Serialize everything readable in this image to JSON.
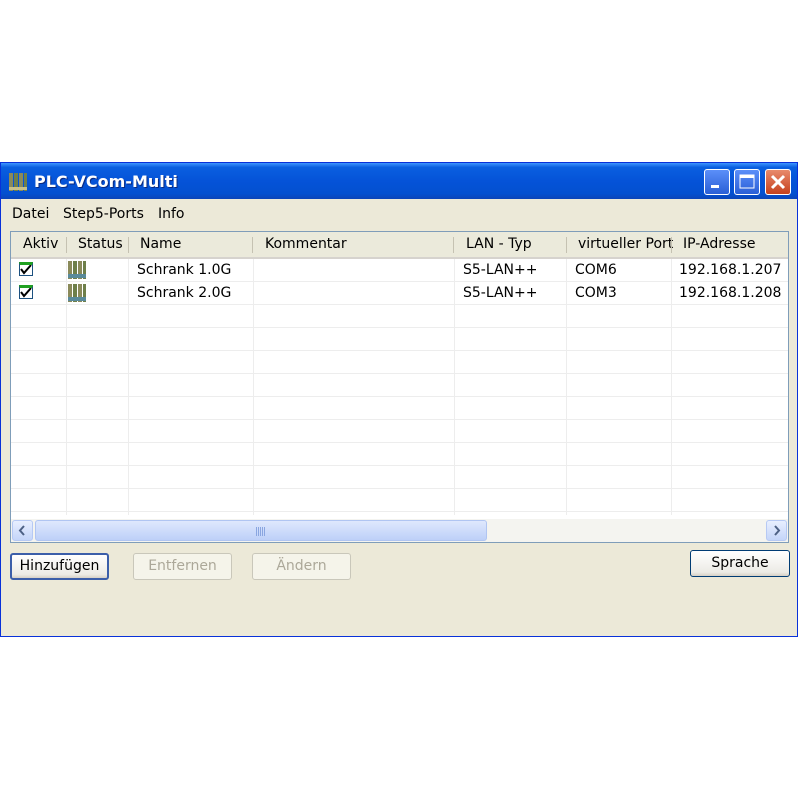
{
  "window": {
    "title": "PLC-VCom-Multi",
    "colors": {
      "titlebar": "#0553d8",
      "close": "#c6411e",
      "dialog_bg": "#ece9d8"
    }
  },
  "menu": [
    "Datei",
    "Step5-Ports",
    "Info"
  ],
  "table": {
    "columns": [
      "Aktiv",
      "Status",
      "Name",
      "Kommentar",
      "LAN - Typ",
      "virtueller Port",
      "IP-Adresse"
    ],
    "rows": [
      {
        "active": true,
        "status_icon": "plc-status-icon",
        "name": "Schrank 1.0G",
        "comment": "",
        "lan_type": "S5-LAN++",
        "port": "COM6",
        "ip": "192.168.1.207"
      },
      {
        "active": true,
        "status_icon": "plc-status-icon",
        "name": "Schrank 2.0G",
        "comment": "",
        "lan_type": "S5-LAN++",
        "port": "COM3",
        "ip": "192.168.1.208"
      }
    ]
  },
  "buttons": {
    "add": "Hinzufügen",
    "remove": "Entfernen",
    "change": "Ändern",
    "language": "Sprache"
  }
}
